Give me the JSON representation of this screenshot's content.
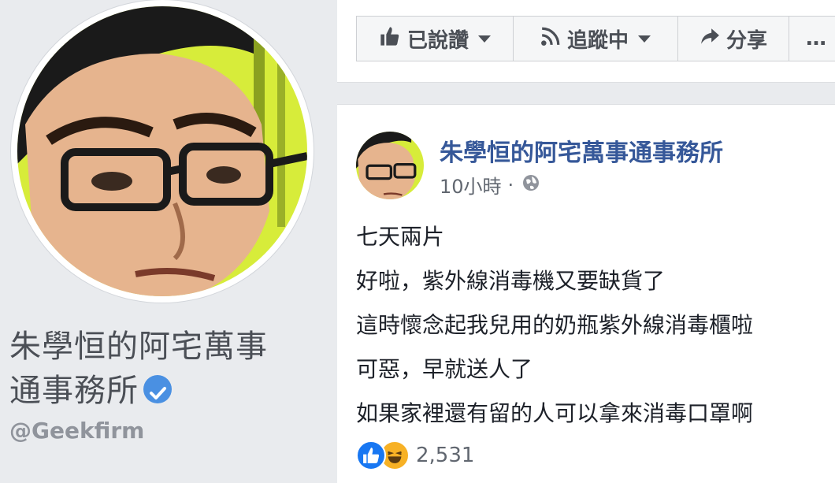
{
  "profile": {
    "name": "朱學恒的阿宅萬事通事務所",
    "name_line1": "朱學恒的阿宅萬事",
    "name_line2": "通事務所",
    "handle": "@Geekfirm",
    "verified_color": "#4a90e2"
  },
  "actions": [
    {
      "label": "已說讚",
      "icon": "thumbs-up-icon",
      "dropdown": true
    },
    {
      "label": "追蹤中",
      "icon": "rss-icon",
      "dropdown": true
    },
    {
      "label": "分享",
      "icon": "share-arrow-icon",
      "dropdown": false
    },
    {
      "label": "…",
      "icon": "more-icon",
      "dropdown": false
    }
  ],
  "post": {
    "author": "朱學恒的阿宅萬事通事務所",
    "time": "10小時",
    "separator": "·",
    "privacy_icon": "globe-icon",
    "lines": [
      "七天兩片",
      "好啦，紫外線消毒機又要缺貨了",
      "這時懷念起我兒用的奶瓶紫外線消毒櫃啦",
      "可惡，早就送人了",
      "如果家裡還有留的人可以拿來消毒口罩啊"
    ],
    "reaction_count": "2,531",
    "reaction_icons": [
      "like-reaction-icon",
      "haha-reaction-icon"
    ]
  },
  "colors": {
    "background": "#e9ebee",
    "link_blue": "#365899",
    "like_blue": "#1877f2",
    "haha_yellow": "#f7b125"
  }
}
